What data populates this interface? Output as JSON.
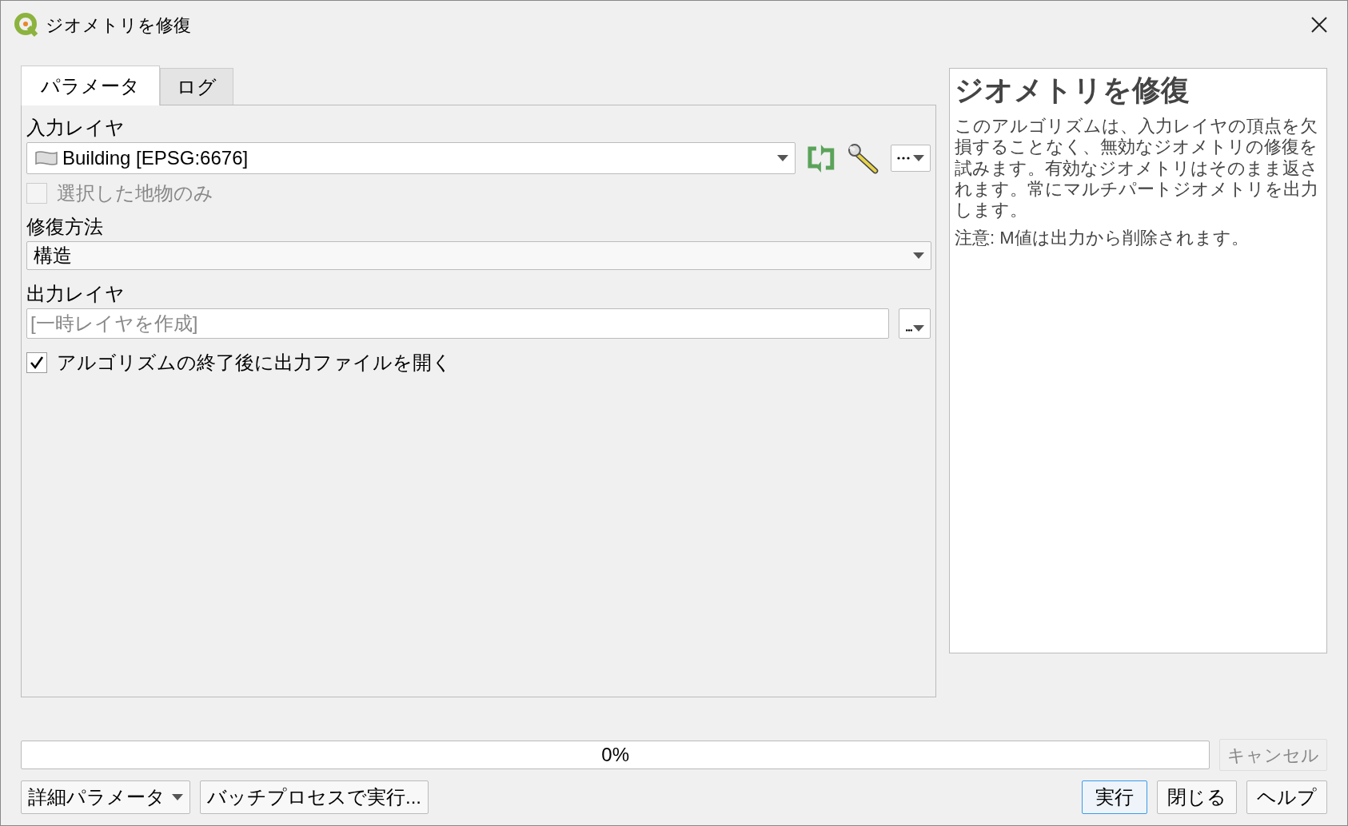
{
  "window": {
    "title": "ジオメトリを修復"
  },
  "tabs": [
    {
      "label": "パラメータ",
      "selected": true
    },
    {
      "label": "ログ",
      "selected": false
    }
  ],
  "parameters": {
    "input_layer": {
      "label": "入力レイヤ",
      "value": "Building [EPSG:6676]"
    },
    "selected_only": {
      "label": "選択した地物のみ",
      "checked": false,
      "disabled": true
    },
    "fix_method": {
      "label": "修復方法",
      "value": "構造"
    },
    "output_layer": {
      "label": "出力レイヤ",
      "placeholder": "[一時レイヤを作成]"
    },
    "open_output": {
      "label": "アルゴリズムの終了後に出力ファイルを開く",
      "checked": true
    }
  },
  "help": {
    "title": "ジオメトリを修復",
    "paragraphs": [
      "このアルゴリズムは、入力レイヤの頂点を欠損することなく、無効なジオメトリの修復を試みます。有効なジオメトリはそのまま返されます。常にマルチパートジオメトリを出力します。",
      "注意: M値は出力から削除されます。"
    ]
  },
  "progress": {
    "reading": "0%",
    "level": 0
  },
  "cancel": {
    "label": "キャンセル",
    "disabled": true
  },
  "advanced": {
    "label": "詳細パラメータ"
  },
  "batch": {
    "label": "バッチプロセスで実行..."
  },
  "actions": [
    {
      "label": "実行",
      "selected": true
    },
    {
      "label": "閉じる",
      "selected": false
    },
    {
      "label": "ヘルプ",
      "selected": false
    }
  ]
}
